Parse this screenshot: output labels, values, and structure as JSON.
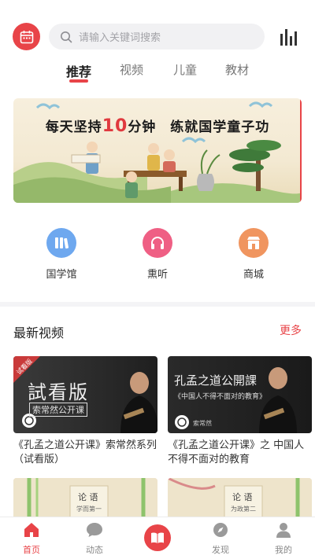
{
  "header": {
    "search_placeholder": "请输入关键词搜索"
  },
  "tabs": [
    {
      "label": "推荐",
      "active": true
    },
    {
      "label": "视频",
      "active": false
    },
    {
      "label": "儿童",
      "active": false
    },
    {
      "label": "教材",
      "active": false
    }
  ],
  "banner": {
    "title_pre": "每天坚持",
    "title_num": "10",
    "title_post": "分钟　练就国学童子功"
  },
  "quick_links": [
    {
      "label": "国学馆",
      "icon": "books-icon",
      "color": "#6ea8ef"
    },
    {
      "label": "熏听",
      "icon": "headphones-icon",
      "color": "#ef5f84"
    },
    {
      "label": "商城",
      "icon": "shop-icon",
      "color": "#f0955f"
    }
  ],
  "section": {
    "title": "最新视频",
    "more": "更多"
  },
  "videos": [
    {
      "title": "《孔孟之道公开课》索常然系列（试看版）",
      "thumb_tag": "试看版",
      "thumb_main": "試看版",
      "thumb_sub": "索常然公开课"
    },
    {
      "title": "《孔孟之道公开课》之 中国人不得不面对的教育",
      "thumb_main": "孔孟之道公開課",
      "thumb_sub": "《中国人不得不面对的教育》",
      "thumb_author": "索常然"
    },
    {
      "thumb_main": "论 语",
      "thumb_sub": "学而第一"
    },
    {
      "thumb_main": "论 语",
      "thumb_sub": "为政第二"
    }
  ],
  "bottom_nav": [
    {
      "label": "首页",
      "icon": "home-icon",
      "active": true
    },
    {
      "label": "动态",
      "icon": "chat-icon",
      "active": false
    },
    {
      "label": "发现",
      "icon": "compass-icon",
      "active": false
    },
    {
      "label": "我的",
      "icon": "user-icon",
      "active": false
    }
  ],
  "center_button_icon": "book-icon",
  "colors": {
    "accent": "#e84448"
  }
}
